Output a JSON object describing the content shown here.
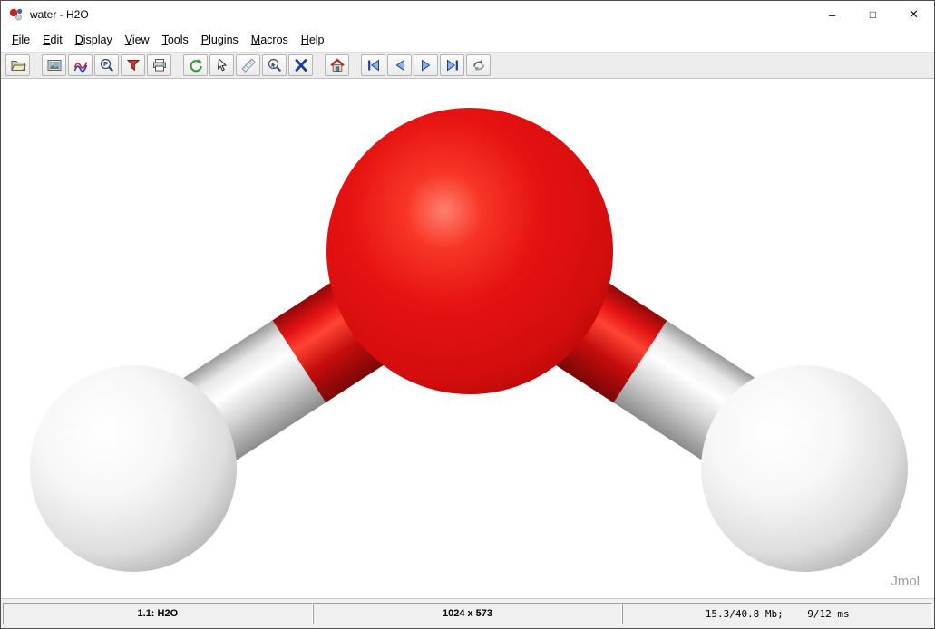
{
  "window": {
    "title": "water - H2O",
    "controls": {
      "minimize": "–",
      "maximize": "□",
      "close": "✕"
    }
  },
  "menubar": {
    "items": [
      {
        "label": "File"
      },
      {
        "label": "Edit"
      },
      {
        "label": "Display"
      },
      {
        "label": "View"
      },
      {
        "label": "Tools"
      },
      {
        "label": "Plugins"
      },
      {
        "label": "Macros"
      },
      {
        "label": "Help"
      }
    ]
  },
  "toolbar": {
    "p_glyph": "P",
    "buttons": [
      {
        "name": "open"
      },
      {
        "name": "export-image"
      },
      {
        "name": "spectrum"
      },
      {
        "name": "p-tool"
      },
      {
        "name": "annotate"
      },
      {
        "name": "print"
      },
      {
        "name": "rotate"
      },
      {
        "name": "select"
      },
      {
        "name": "measure"
      },
      {
        "name": "zoom"
      },
      {
        "name": "axes"
      },
      {
        "name": "home"
      },
      {
        "name": "first-frame"
      },
      {
        "name": "previous-frame"
      },
      {
        "name": "next-frame"
      },
      {
        "name": "last-frame"
      },
      {
        "name": "resume-animation"
      }
    ]
  },
  "viewport": {
    "watermark": "Jmol"
  },
  "molecule": {
    "name": "water",
    "formula": "H2O",
    "atoms": [
      {
        "element": "O",
        "color": "#e01010"
      },
      {
        "element": "H",
        "color": "#ffffff"
      },
      {
        "element": "H",
        "color": "#ffffff"
      }
    ],
    "bonds": [
      {
        "from": "O",
        "to": "H1"
      },
      {
        "from": "O",
        "to": "H2"
      }
    ]
  },
  "statusbar": {
    "frame": "1.1: H2O",
    "size": "1024 x 573",
    "memory": "15.3/40.8 Mb;    9/12 ms"
  }
}
